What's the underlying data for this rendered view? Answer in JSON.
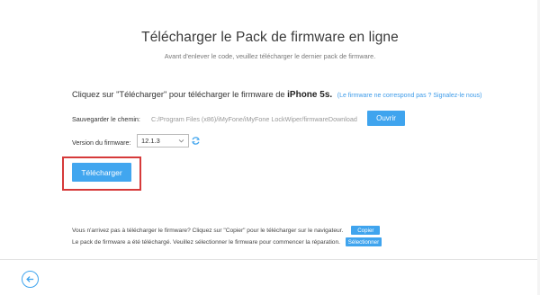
{
  "header": {
    "title": "Télécharger le Pack de firmware en ligne",
    "subtitle": "Avant d'enlever le code, veuillez télécharger le dernier pack de firmware."
  },
  "firmware": {
    "intro_text": "Cliquez sur \"Télécharger\" pour télécharger le firmware de ",
    "device_model": "iPhone 5s.",
    "report_link": "(Le firmware ne correspond pas ? Signalez-le nous)",
    "save_path_label": "Sauvegarder le chemin:",
    "save_path_value": "C:/Program Files (x86)/iMyFone/iMyFone LockWiper/firmwareDownload",
    "browse_label": "Ouvrir",
    "version_label": "Version du firmware:",
    "version_selected": "12.1.3",
    "download_label": "Télécharger"
  },
  "notes": {
    "copy_text": "Vous n'arrivez pas à télécharger le firmware? Cliquez sur \"Copier\" pour le télécharger sur le navigateur.",
    "copy_label": "Copier",
    "select_text": "Le pack de firmware a été téléchargé. Veuillez sélectionner le firmware pour commencer la réparation.",
    "select_label": "Sélectionner"
  },
  "footer": {
    "back_icon": "back-arrow-icon"
  },
  "colors": {
    "accent": "#3fa4ee",
    "highlight": "#d63a3a"
  }
}
